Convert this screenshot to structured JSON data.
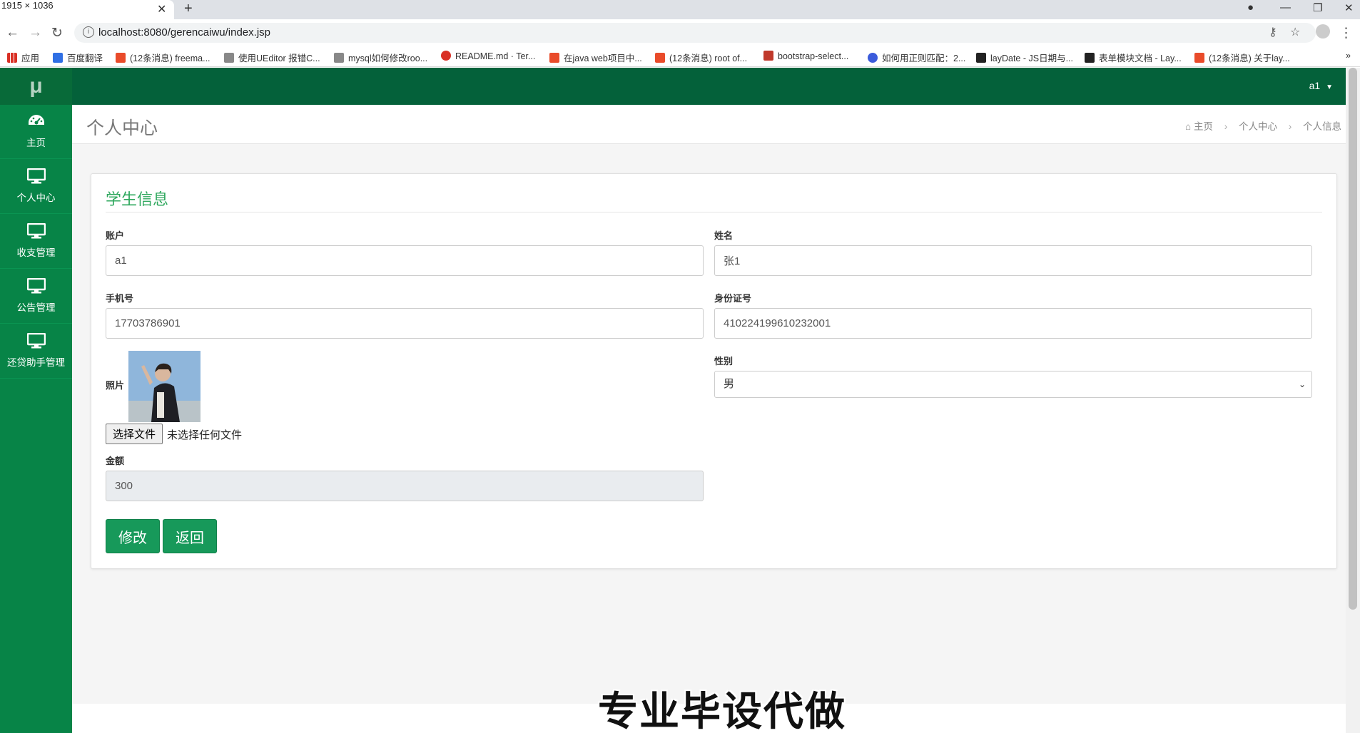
{
  "browser": {
    "tab_overlay_text": "1915 × 1036",
    "url": "localhost:8080/gerencaiwu/index.jsp",
    "bookmarks": [
      {
        "label": "应用",
        "color": "#d93025"
      },
      {
        "label": "百度翻译",
        "color": "#2f6fe4"
      },
      {
        "label": "(12条消息) freema...",
        "color": "#e94b2a"
      },
      {
        "label": "使用UEditor 报错C...",
        "color": "#555555"
      },
      {
        "label": "mysql如何修改roo...",
        "color": "#555555"
      },
      {
        "label": "README.md · Ter...",
        "color": "#d93025"
      },
      {
        "label": "在java web项目中...",
        "color": "#e94b2a"
      },
      {
        "label": "(12条消息) root of...",
        "color": "#e94b2a"
      },
      {
        "label": "bootstrap-select...",
        "color": "#c0392b"
      },
      {
        "label": "如何用正则匹配：2...",
        "color": "#3b5bdb"
      },
      {
        "label": "layDate - JS日期与...",
        "color": "#222222"
      },
      {
        "label": "表单模块文档 - Lay...",
        "color": "#222222"
      },
      {
        "label": "(12条消息) 关于lay...",
        "color": "#e94b2a"
      }
    ]
  },
  "sidebar": {
    "logo": "μ",
    "items": [
      {
        "label": "主页",
        "icon": "dashboard-icon"
      },
      {
        "label": "个人中心",
        "icon": "monitor-icon"
      },
      {
        "label": "收支管理",
        "icon": "monitor-icon"
      },
      {
        "label": "公告管理",
        "icon": "monitor-icon"
      },
      {
        "label": "还贷助手管理",
        "icon": "monitor-icon"
      }
    ]
  },
  "topbar": {
    "user": "a1"
  },
  "header": {
    "title": "个人中心",
    "breadcrumb": [
      "主页",
      "个人中心",
      "个人信息"
    ]
  },
  "form": {
    "title": "学生信息",
    "account_label": "账户",
    "account_value": "a1",
    "name_label": "姓名",
    "name_value": "张1",
    "phone_label": "手机号",
    "phone_value": "17703786901",
    "idcard_label": "身份证号",
    "idcard_value": "410224199610232001",
    "photo_label": "照片",
    "file_button": "选择文件",
    "file_status": "未选择任何文件",
    "gender_label": "性别",
    "gender_value": "男",
    "amount_label": "金额",
    "amount_value": "300",
    "submit_label": "修改",
    "back_label": "返回"
  },
  "watermark": "专业毕设代做",
  "colors": {
    "sidebar": "#078447",
    "topbar": "#04613a",
    "accent": "#2fa85e",
    "button": "#17995a"
  }
}
